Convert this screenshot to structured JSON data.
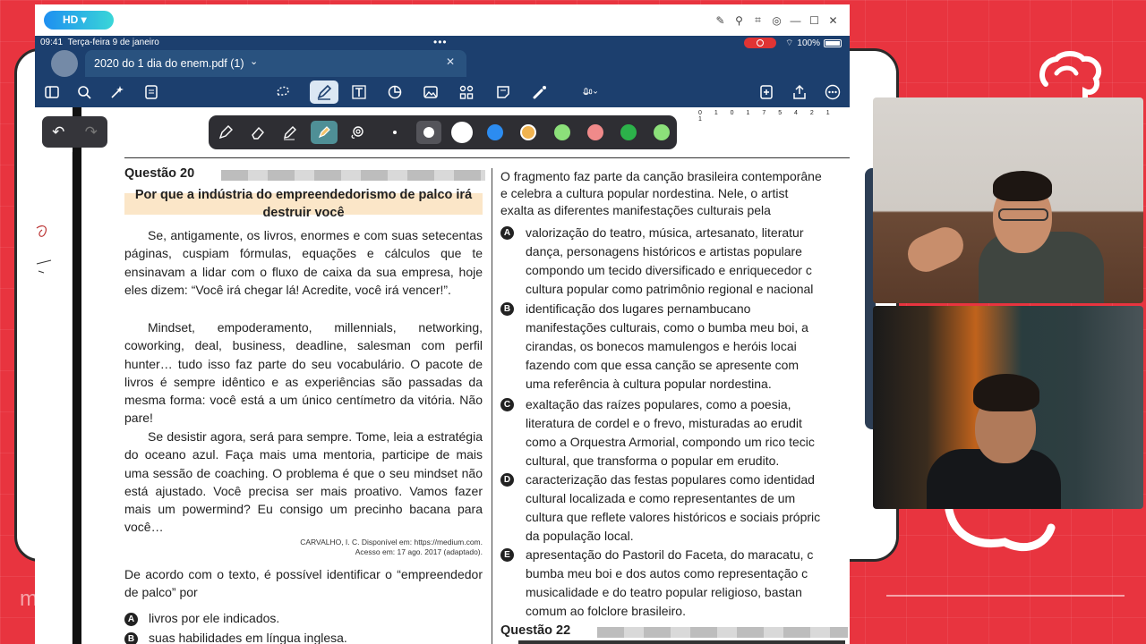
{
  "window": {
    "quality_badge": "HD",
    "status": {
      "time": "09:41",
      "date": "Terça-feira 9 de janeiro",
      "battery": "100%"
    },
    "tab": {
      "title": "2020 do 1 dia do enem.pdf (1)"
    }
  },
  "toolbar": {
    "left": [
      "sidebar-icon",
      "search-icon",
      "magic-icon",
      "document-icon"
    ],
    "center": [
      "lasso-icon",
      "pen-icon",
      "text-icon",
      "shape-icon",
      "image-icon",
      "elements-icon",
      "sticky-icon",
      "laser-icon",
      "mic-icon"
    ],
    "right": [
      "export-icon",
      "share-icon",
      "more-icon"
    ]
  },
  "penbar": {
    "tools": [
      "fountain-pen-icon",
      "eraser-icon",
      "pencil-icon",
      "highlighter-icon",
      "lasso-tool-icon"
    ],
    "colors": [
      "#ffffff",
      "#2c8cf0",
      "#f0b350",
      "#8ce07a",
      "#f08a8a",
      "#2cb24a",
      "#8ce07a"
    ]
  },
  "document": {
    "page_marker": "0 1 0 1 7 5 4 2 1 1",
    "question20": {
      "heading": "Questão 20",
      "title": "Por que a indústria do empreendedorismo de palco irá destruir você",
      "paragraphs": [
        "Se, antigamente, os livros, enormes e com suas setecentas páginas, cuspiam fórmulas, equações e cálculos que te ensinavam a lidar com o fluxo de caixa da sua empresa, hoje eles dizem: “Você irá chegar lá! Acredite, você irá vencer!”.",
        "Mindset, empoderamento, millennials, networking, coworking, deal, business, deadline, salesman com perfil hunter… tudo isso faz parte do seu vocabulário. O pacote de livros é sempre idêntico e as experiências são passadas da mesma forma: você está a um único centímetro da vitória. Não pare!",
        "Se desistir agora, será para sempre. Tome, leia a estratégia do oceano azul. Faça mais uma mentoria, participe de mais uma sessão de coaching. O problema é que o seu mindset não está ajustado. Você precisa ser mais proativo. Vamos fazer mais um powermind? Eu consigo um precinho bacana para você…"
      ],
      "source_line1": "CARVALHO, I. C. Disponível em: https://medium.com.",
      "source_line2": "Acesso em: 17 ago. 2017 (adaptado).",
      "stem": "De acordo com o texto, é possível identificar o “empreendedor de palco” por",
      "options": [
        {
          "letter": "A",
          "text": "livros por ele indicados."
        },
        {
          "letter": "B",
          "text": "suas habilidades em língua inglesa."
        }
      ]
    },
    "question21": {
      "intro_lines": [
        "O fragmento faz parte da canção brasileira contemporâne",
        "e celebra a cultura popular nordestina. Nele, o artist",
        "exalta as diferentes manifestações culturais pela"
      ],
      "options": [
        {
          "letter": "A",
          "lines": [
            "valorização do teatro, música, artesanato, literatur",
            "dança, personagens históricos e artistas populare",
            "compondo um tecido diversificado e enriquecedor c",
            "cultura popular como patrimônio regional e nacional"
          ]
        },
        {
          "letter": "B",
          "lines": [
            "identificação dos lugares pernambucano",
            "manifestações culturais, como o bumba meu boi, a",
            "cirandas, os bonecos mamulengos e heróis locai",
            "fazendo com que essa canção se apresente com",
            "uma referência à cultura popular nordestina."
          ]
        },
        {
          "letter": "C",
          "lines": [
            "exaltação das raízes populares, como a poesia,",
            "literatura de cordel e o frevo, misturadas ao erudit",
            "como a Orquestra Armorial, compondo um rico tecic",
            "cultural, que transforma o popular em erudito."
          ]
        },
        {
          "letter": "D",
          "lines": [
            "caracterização das festas populares como identidad",
            "cultural localizada e como representantes de um",
            "cultura que reflete valores históricos e sociais própric",
            "da população local."
          ]
        },
        {
          "letter": "E",
          "lines": [
            "apresentação do Pastoril do Faceta, do maracatu, c",
            "bumba meu boi e dos autos como representação c",
            "musicalidade e do teatro popular religioso, bastan",
            "comum ao folclore brasileiro."
          ]
        }
      ]
    },
    "question22": {
      "heading": "Questão 22"
    }
  },
  "background": {
    "accent": "#e8343f",
    "letter": "m"
  }
}
